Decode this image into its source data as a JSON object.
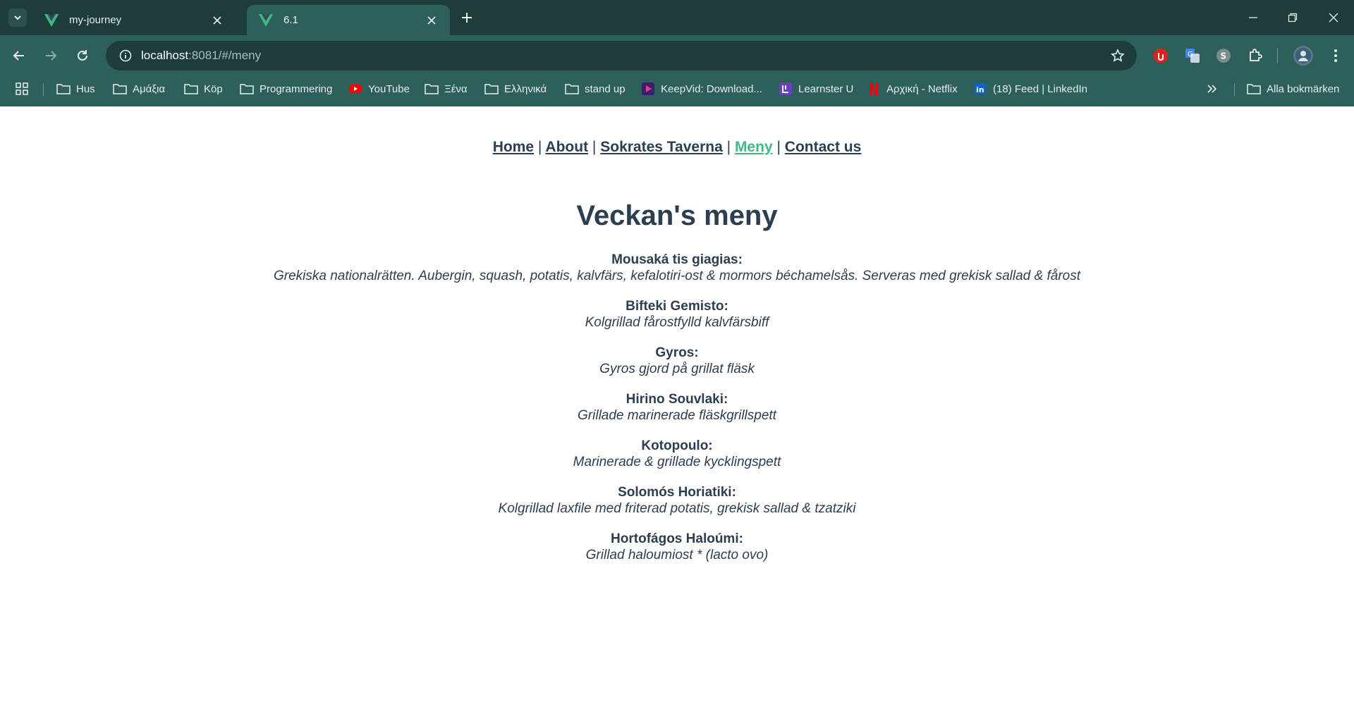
{
  "browser": {
    "tabs": [
      {
        "title": "my-journey",
        "active": false
      },
      {
        "title": "6.1",
        "active": true
      }
    ],
    "url_host": "localhost",
    "url_rest": ":8081/#/meny",
    "bookmarks": [
      {
        "label": "Hus",
        "icon": "folder-icon"
      },
      {
        "label": "Αμάξια",
        "icon": "folder-icon"
      },
      {
        "label": "Köp",
        "icon": "folder-icon"
      },
      {
        "label": "Programmering",
        "icon": "folder-icon"
      },
      {
        "label": "YouTube",
        "icon": "youtube-icon"
      },
      {
        "label": "Ξένα",
        "icon": "folder-icon"
      },
      {
        "label": "Ελληνικά",
        "icon": "folder-icon"
      },
      {
        "label": "stand up",
        "icon": "folder-icon"
      },
      {
        "label": "KeepVid: Download...",
        "icon": "keepvid-icon"
      },
      {
        "label": "Learnster U",
        "icon": "learnster-icon"
      },
      {
        "label": "Αρχική - Netflix",
        "icon": "netflix-icon"
      },
      {
        "label": "(18) Feed | LinkedIn",
        "icon": "linkedin-icon"
      }
    ],
    "all_bookmarks_label": "Alla bokmärken",
    "colors": {
      "tabstrip": "#1d3c3a",
      "toolbar": "#2d5f5b",
      "vue_green": "#42b983"
    }
  },
  "page": {
    "nav": [
      {
        "label": "Home",
        "active": false
      },
      {
        "label": "About",
        "active": false
      },
      {
        "label": "Sokrates Taverna",
        "active": false
      },
      {
        "label": "Meny",
        "active": true
      },
      {
        "label": "Contact us",
        "active": false
      }
    ],
    "nav_separator": "|",
    "title": "Veckan's meny",
    "menu": [
      {
        "dish": "Mousaká tis giagias:",
        "description": "Grekiska nationalrätten. Aubergin, squash, potatis, kalvfärs, kefalotiri-ost & mormors béchamelsås. Serveras med grekisk sallad & fårost"
      },
      {
        "dish": "Bifteki Gemisto:",
        "description": "Kolgrillad fårostfylld kalvfärsbiff"
      },
      {
        "dish": "Gyros:",
        "description": "Gyros gjord på grillat fläsk"
      },
      {
        "dish": "Hirino Souvlaki:",
        "description": "Grillade marinerade fläskgrillspett"
      },
      {
        "dish": "Kotopoulo:",
        "description": "Marinerade & grillade kycklingspett"
      },
      {
        "dish": "Solomós Horiatiki:",
        "description": "Kolgrillad laxfile med friterad potatis, grekisk sallad & tzatziki"
      },
      {
        "dish": "Hortofágos Haloúmi:",
        "description": "Grillad haloumiost * (lacto ovo)"
      }
    ],
    "colors": {
      "text": "#2c3e50",
      "active_link": "#42b983"
    }
  }
}
